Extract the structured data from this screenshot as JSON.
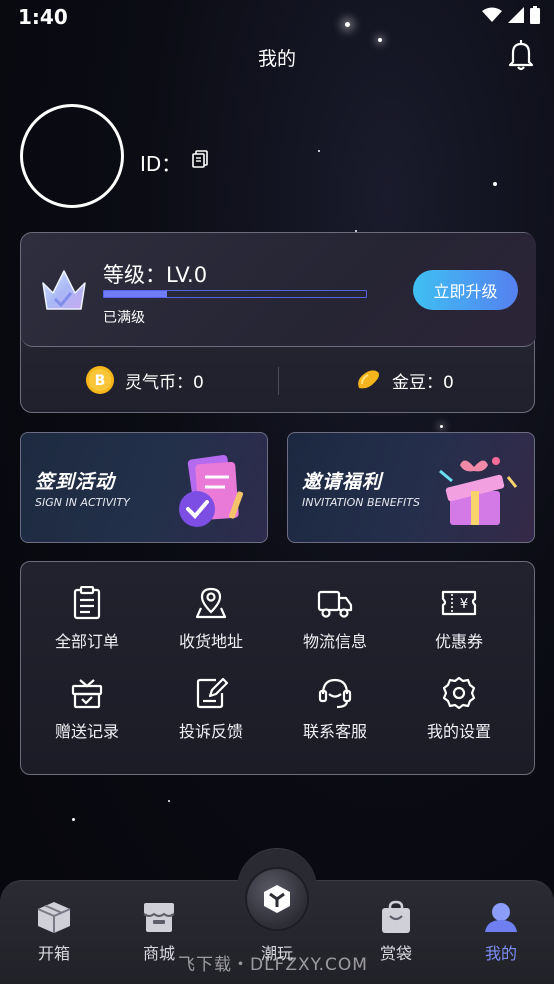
{
  "status_bar": {
    "time": "1:40"
  },
  "header": {
    "title": "我的"
  },
  "profile": {
    "id_label": "ID："
  },
  "level_card": {
    "level_text": "等级：LV.0",
    "level_progress": 0.24,
    "sub_text": "已满级",
    "upgrade_label": "立即升级",
    "coins": [
      {
        "icon": "bitcoin-coin-icon",
        "label": "灵气币：0"
      },
      {
        "icon": "gold-bean-icon",
        "label": "金豆：0"
      }
    ]
  },
  "promos": [
    {
      "title": "签到活动",
      "subtitle": "SIGN IN ACTIVITY",
      "icon": "sign-in-calendar-icon"
    },
    {
      "title": "邀请福利",
      "subtitle": "INVITATION BENEFITS",
      "icon": "gift-box-icon"
    }
  ],
  "menu": {
    "items": [
      {
        "label": "全部订单",
        "icon": "order-list-icon"
      },
      {
        "label": "收货地址",
        "icon": "location-pin-icon"
      },
      {
        "label": "物流信息",
        "icon": "truck-icon"
      },
      {
        "label": "优惠券",
        "icon": "coupon-icon"
      },
      {
        "label": "赠送记录",
        "icon": "gift-icon"
      },
      {
        "label": "投诉反馈",
        "icon": "feedback-edit-icon"
      },
      {
        "label": "联系客服",
        "icon": "headset-icon"
      },
      {
        "label": "我的设置",
        "icon": "settings-gear-icon"
      }
    ]
  },
  "bottom_nav": {
    "items": [
      {
        "label": "开箱",
        "icon": "box-icon",
        "active": false
      },
      {
        "label": "商城",
        "icon": "shop-icon",
        "active": false
      },
      {
        "label": "潮玩",
        "icon": "cube-icon",
        "active": false
      },
      {
        "label": "赏袋",
        "icon": "bag-icon",
        "active": false
      },
      {
        "label": "我的",
        "icon": "user-icon",
        "active": true
      }
    ],
    "active_color": "#7c8ef8"
  },
  "watermark": "飞下载・DLFZXY.COM"
}
